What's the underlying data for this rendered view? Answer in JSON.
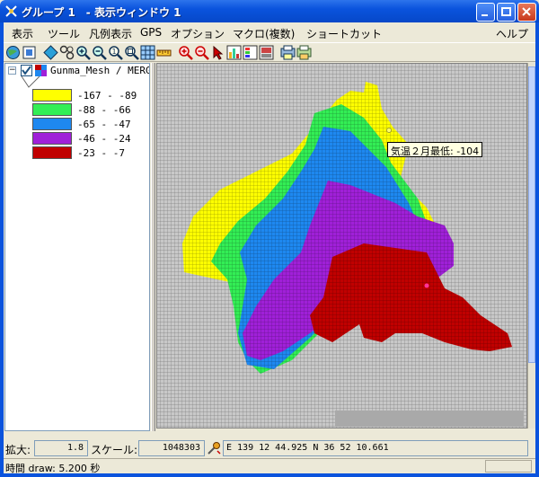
{
  "window": {
    "title": "グループ 1　- 表示ウィンドウ 1"
  },
  "menu": [
    "表示",
    "ツール",
    "凡例表示",
    "GPS",
    "オプション",
    "マクロ(複数)",
    "ショートカット",
    "ヘルプ"
  ],
  "layer": {
    "name": "Gunma_Mesh / MERGE",
    "checked": true
  },
  "legend": [
    {
      "label": "-167 - -89",
      "color": "#ffff00"
    },
    {
      "label": "-88 - -66",
      "color": "#33ee55"
    },
    {
      "label": "-65 - -47",
      "color": "#1e88f0"
    },
    {
      "label": "-46 - -24",
      "color": "#a020d8"
    },
    {
      "label": "-23 - -7",
      "color": "#c00000"
    }
  ],
  "tooltip": "気温２月最低: -104",
  "status": {
    "zoom_label": "拡大:",
    "zoom_value": "1.8",
    "scale_label": "スケール:",
    "scale_value": "1048303",
    "coords": "E 139 12 44.925  N 36 52 10.661",
    "draw_time": "時間 draw: 5.200 秒"
  },
  "toolbar_icons": [
    "globe-icon",
    "fit-icon",
    "layer-diamond-icon",
    "pan-icon",
    "zoom-in-icon",
    "zoom-out-icon",
    "zoom-previous-icon",
    "zoom-extent-icon",
    "grid-icon",
    "measure-icon",
    "zoom-in-red-icon",
    "zoom-out-red-icon",
    "select-arrow-icon",
    "chart-icon",
    "legend-icon",
    "layout-icon",
    "print-icon",
    "export-icon"
  ]
}
